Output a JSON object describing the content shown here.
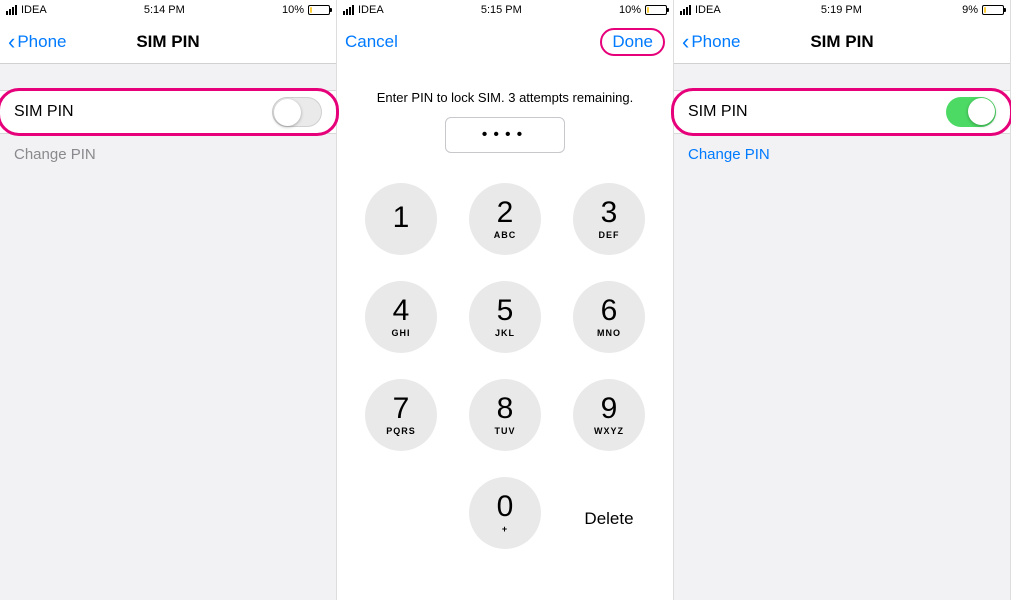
{
  "screen1": {
    "status": {
      "carrier": "IDEA",
      "time": "5:14 PM",
      "battery": "10%"
    },
    "nav": {
      "back": "Phone",
      "title": "SIM PIN"
    },
    "sim_pin_label": "SIM PIN",
    "sim_pin_toggle_on": false,
    "change_pin": "Change PIN"
  },
  "screen2": {
    "status": {
      "carrier": "IDEA",
      "time": "5:15 PM",
      "battery": "10%"
    },
    "nav": {
      "cancel": "Cancel",
      "done": "Done"
    },
    "prompt": "Enter PIN to lock SIM. 3 attempts remaining.",
    "pin_dots": "••••",
    "keypad": [
      {
        "d": "1",
        "l": ""
      },
      {
        "d": "2",
        "l": "ABC"
      },
      {
        "d": "3",
        "l": "DEF"
      },
      {
        "d": "4",
        "l": "GHI"
      },
      {
        "d": "5",
        "l": "JKL"
      },
      {
        "d": "6",
        "l": "MNO"
      },
      {
        "d": "7",
        "l": "PQRS"
      },
      {
        "d": "8",
        "l": "TUV"
      },
      {
        "d": "9",
        "l": "WXYZ"
      }
    ],
    "zero": {
      "d": "0",
      "l": "+"
    },
    "delete": "Delete"
  },
  "screen3": {
    "status": {
      "carrier": "IDEA",
      "time": "5:19 PM",
      "battery": "9%"
    },
    "nav": {
      "back": "Phone",
      "title": "SIM PIN"
    },
    "sim_pin_label": "SIM PIN",
    "sim_pin_toggle_on": true,
    "change_pin": "Change PIN"
  }
}
